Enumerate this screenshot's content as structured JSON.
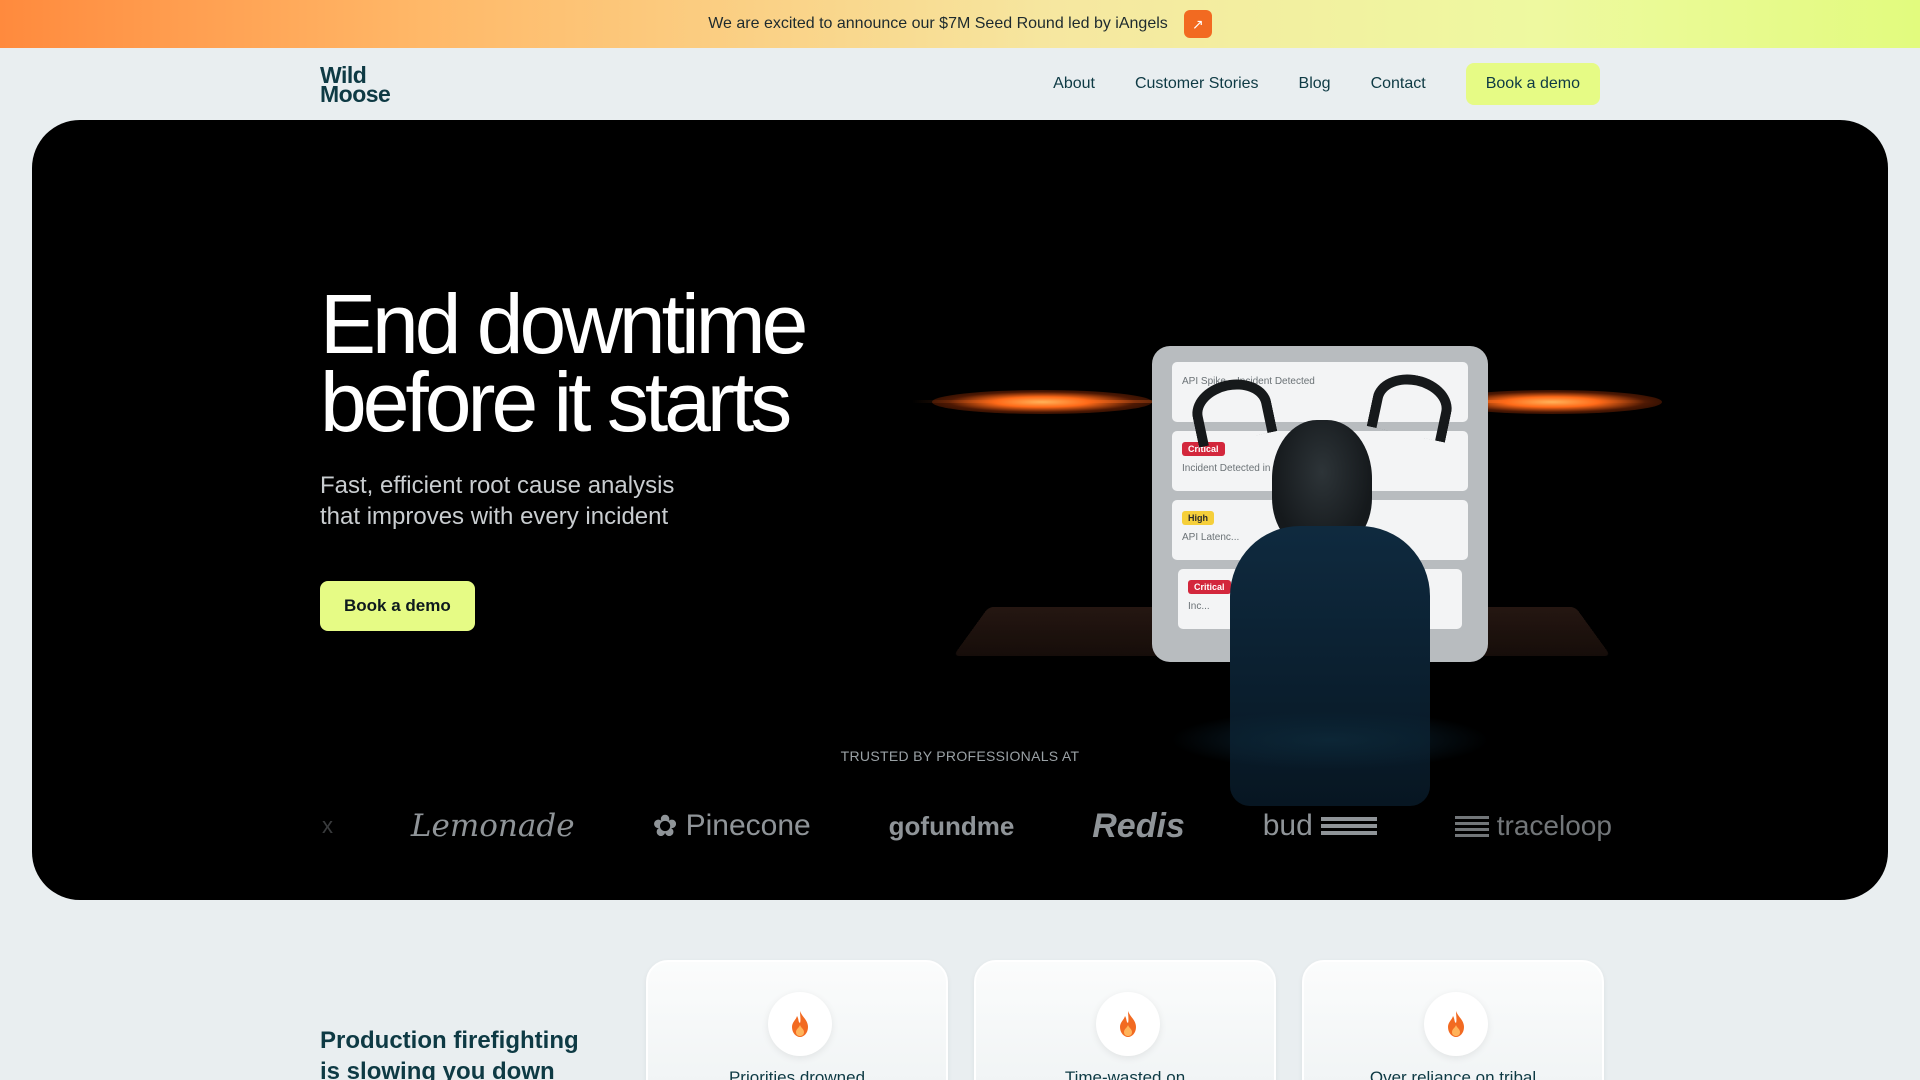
{
  "announcement": {
    "text": "We are excited to announce our $7M Seed Round led by iAngels",
    "arrow_icon": "arrow-up-right-icon"
  },
  "nav": {
    "logo_line1": "Wild",
    "logo_line2": "Moose",
    "links": [
      "About",
      "Customer Stories",
      "Blog",
      "Contact"
    ],
    "cta": "Book a demo"
  },
  "hero": {
    "title_line1": "End downtime",
    "title_line2": "before it starts",
    "subtitle_line1": "Fast, efficient root cause analysis",
    "subtitle_line2": "that improves with every incident",
    "cta": "Book a demo",
    "incident_cards": [
      {
        "badge": "",
        "text": "API Spike... Incident Detected"
      },
      {
        "badge": "Critical",
        "text": "Incident Detected in ... Buffering Spike"
      },
      {
        "badge": "High",
        "text": "API Latenc..."
      },
      {
        "badge": "Critical",
        "text": "Inc..."
      }
    ]
  },
  "trusted": {
    "label": "TRUSTED BY PROFESSIONALS AT",
    "logos": [
      "x",
      "Lemonade",
      "Pinecone",
      "gofundme",
      "Redis",
      "bud",
      "traceloop"
    ]
  },
  "problems": {
    "title_line1": "Production firefighting",
    "title_line2": "is slowing you down",
    "cards": [
      {
        "label": "Priorities drowned",
        "icon": "fire-icon"
      },
      {
        "label": "Time-wasted on",
        "icon": "fire-icon"
      },
      {
        "label": "Over reliance on tribal",
        "icon": "fire-icon"
      }
    ]
  },
  "colors": {
    "accent": "#e6fb85",
    "brand_dark": "#0e3a44",
    "announce_arrow": "#f26a21",
    "critical": "#d3273c",
    "high": "#f5cf3a"
  }
}
